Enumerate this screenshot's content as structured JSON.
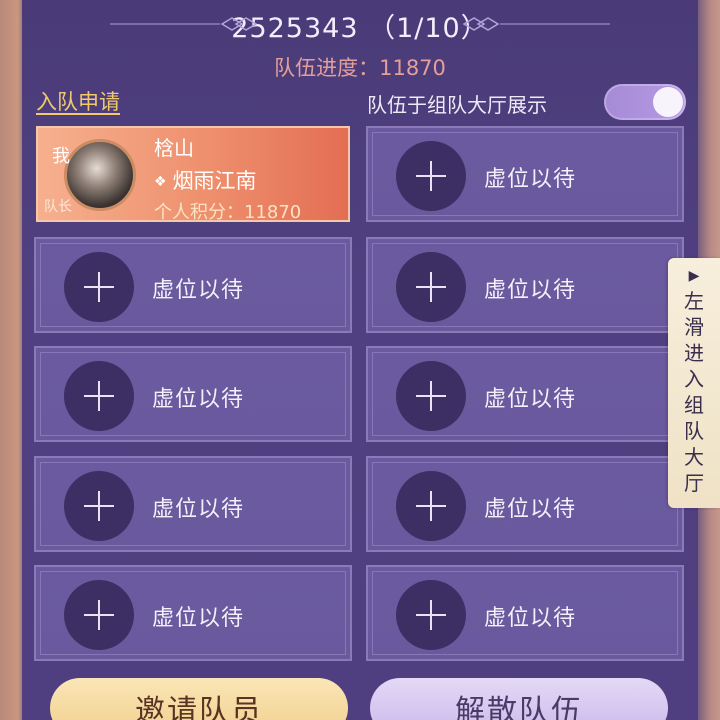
{
  "header": {
    "team_id_line": "2525343 （1/10）",
    "progress": "队伍进度：11870"
  },
  "controls": {
    "join_requests": "入队申请",
    "show_in_hall_label": "队伍于组队大厅展示",
    "show_in_hall_on": true
  },
  "leader": {
    "me_badge": "我",
    "captain_tag": "队长",
    "name": "梒山",
    "server": "烟雨江南",
    "score": "个人积分：11870"
  },
  "empty_slots": [
    {
      "label": "虚位以待"
    },
    {
      "label": "虚位以待"
    },
    {
      "label": "虚位以待"
    },
    {
      "label": "虚位以待"
    },
    {
      "label": "虚位以待"
    },
    {
      "label": "虚位以待"
    },
    {
      "label": "虚位以待"
    },
    {
      "label": "虚位以待"
    },
    {
      "label": "虚位以待"
    }
  ],
  "side_tab": {
    "arrow": "▶",
    "text": "左滑进入组队大厅"
  },
  "buttons": {
    "invite": "邀请队员",
    "disband": "解散队伍"
  },
  "colors": {
    "accent_gold": "#f2c96b",
    "progress_pink": "#e59f9a",
    "leader_card": "#ee8f6d",
    "slot_purple": "#6b5aa0"
  }
}
